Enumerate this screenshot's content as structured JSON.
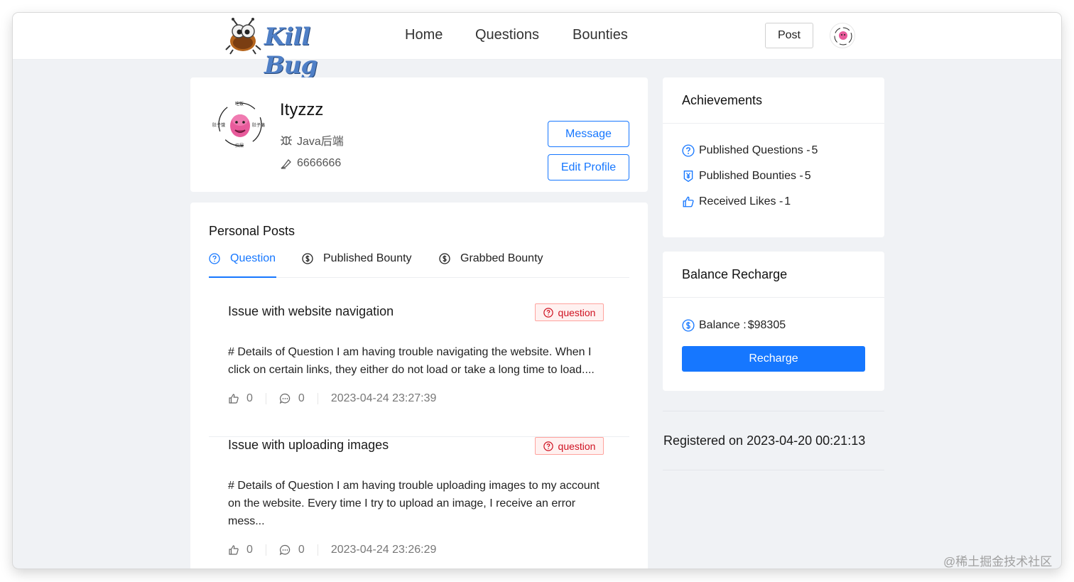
{
  "nav": {
    "logo_text": "Kill Bug",
    "items": [
      "Home",
      "Questions",
      "Bounties"
    ],
    "post_label": "Post"
  },
  "profile": {
    "username": "Ityzzz",
    "role": "Java后端",
    "code": "6666666",
    "message_label": "Message",
    "edit_label": "Edit Profile",
    "avatar_text": {
      "top": "吃饭",
      "left": "肚子饿",
      "right": "肚子痛",
      "bottom": "拉屎"
    }
  },
  "posts": {
    "section_title": "Personal Posts",
    "tabs": [
      {
        "label": "Question",
        "icon": "question-circle-icon"
      },
      {
        "label": "Published Bounty",
        "icon": "dollar-circle-icon"
      },
      {
        "label": "Grabbed Bounty",
        "icon": "dollar-circle-icon"
      }
    ],
    "items": [
      {
        "title": "Issue with website navigation",
        "tag": "question",
        "body_lines": [
          "# Details of Question I am having trouble navigating the website. When I",
          "click on certain links, they either do not load or take a long time to load...."
        ],
        "likes": "0",
        "comments": "0",
        "date": "2023-04-24 23:27:39"
      },
      {
        "title": "Issue with uploading images",
        "tag": "question",
        "body_lines": [
          "# Details of Question I am having trouble uploading images to my account",
          "on the website. Every time I try to upload an image, I receive an error",
          "mess..."
        ],
        "likes": "0",
        "comments": "0",
        "date": "2023-04-24 23:26:29"
      }
    ]
  },
  "achievements": {
    "title": "Achievements",
    "items": [
      {
        "label": "Published Questions - ",
        "value": "5",
        "icon": "question-circle-icon"
      },
      {
        "label": "Published Bounties - ",
        "value": "5",
        "icon": "yen-doc-icon"
      },
      {
        "label": "Received Likes - ",
        "value": "1",
        "icon": "like-icon"
      }
    ]
  },
  "balance": {
    "title": "Balance Recharge",
    "label": "Balance : ",
    "value": "$98305",
    "button": "Recharge"
  },
  "registered": "Registered on 2023-04-20 00:21:13",
  "watermark": "@稀土掘金技术社区",
  "colors": {
    "primary": "#1677ff",
    "tag_red": "#cf1322",
    "bg": "#f0f2f5"
  }
}
